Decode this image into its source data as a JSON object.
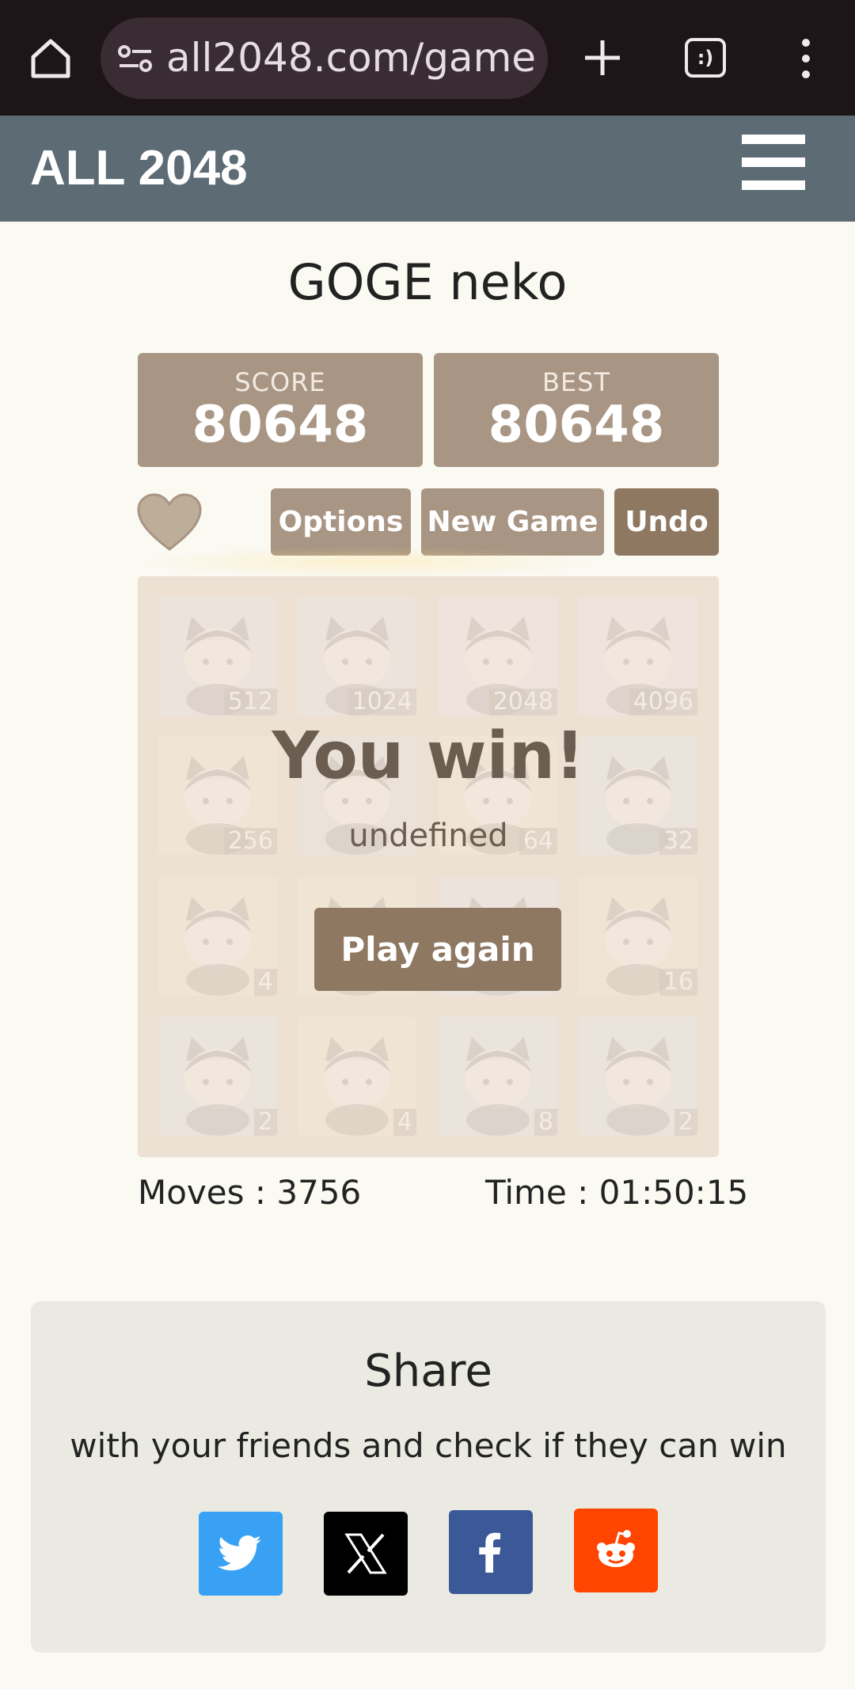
{
  "browser": {
    "url": "all2048.com/game"
  },
  "site": {
    "brand": "ALL 2048"
  },
  "game": {
    "title": "GOGE neko",
    "score_label": "SCORE",
    "score_value": "80648",
    "best_label": "BEST",
    "best_value": "80648",
    "options_label": "Options",
    "newgame_label": "New Game",
    "undo_label": "Undo",
    "tiles": [
      {
        "value": "512",
        "bg": "#e7dfe4"
      },
      {
        "value": "1024",
        "bg": "#e7dfe4"
      },
      {
        "value": "2048",
        "bg": "#ece0e4"
      },
      {
        "value": "4096",
        "bg": "#ece0e4"
      },
      {
        "value": "256",
        "bg": "#f3e2c6"
      },
      {
        "value": "",
        "bg": "#e3dcd8"
      },
      {
        "value": "64",
        "bg": "#f2e2c6"
      },
      {
        "value": "32",
        "bg": "#dde3e7"
      },
      {
        "value": "4",
        "bg": "#f3e2c6"
      },
      {
        "value": "",
        "bg": "#f2e2c6"
      },
      {
        "value": "",
        "bg": "#e3dde3"
      },
      {
        "value": "16",
        "bg": "#f2e2c6"
      },
      {
        "value": "2",
        "bg": "#dfe3e7"
      },
      {
        "value": "4",
        "bg": "#f3e2c6"
      },
      {
        "value": "8",
        "bg": "#dfe1e4"
      },
      {
        "value": "2",
        "bg": "#dfe3e7"
      }
    ],
    "win_message": "You win!",
    "win_sub": "undefined",
    "play_again_label": "Play again",
    "moves_text": "Moves : 3756",
    "time_text": "Time : 01:50:15"
  },
  "share": {
    "title": "Share",
    "subtitle": "with your friends and check if they can win",
    "buttons": [
      {
        "icon": "twitter-bird-icon",
        "color": "#38a1f3"
      },
      {
        "icon": "x-logo-icon",
        "color": "#000000"
      },
      {
        "icon": "facebook-icon",
        "color": "#3b5998"
      },
      {
        "icon": "reddit-icon",
        "color": "#ff4500"
      }
    ]
  }
}
